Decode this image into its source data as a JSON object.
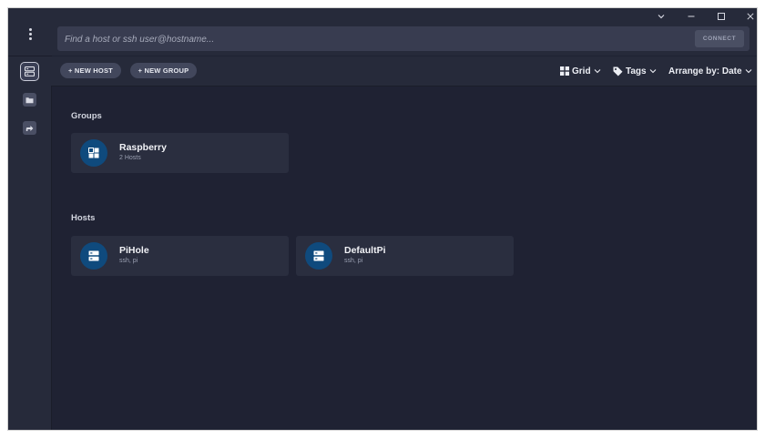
{
  "window_controls": {
    "dropdown": "⌄",
    "minimize": "–",
    "maximize": "☐",
    "close": "✕"
  },
  "search": {
    "placeholder": "Find a host or ssh user@hostname...",
    "value": "",
    "connect_label": "CONNECT"
  },
  "sidebar": {
    "items": [
      {
        "name": "hosts",
        "icon": "server-icon",
        "active": true
      },
      {
        "name": "snippets",
        "icon": "folder-icon",
        "active": false
      },
      {
        "name": "port-forwarding",
        "icon": "forward-arrow-icon",
        "active": false
      }
    ]
  },
  "toolbar": {
    "new_host_label": "+ NEW HOST",
    "new_group_label": "+ NEW GROUP",
    "view_label": "Grid",
    "tags_label": "Tags",
    "arrange_label": "Arrange by: Date"
  },
  "groups": {
    "title": "Groups",
    "items": [
      {
        "name": "Raspberry",
        "subtitle": "2 Hosts",
        "icon": "group-icon"
      }
    ]
  },
  "hosts": {
    "title": "Hosts",
    "items": [
      {
        "name": "PiHole",
        "subtitle": "ssh, pi",
        "icon": "server-icon"
      },
      {
        "name": "DefaultPi",
        "subtitle": "ssh, pi",
        "icon": "server-icon"
      }
    ]
  },
  "colors": {
    "accent": "#0f4a7d",
    "background": "#1f2233",
    "panel": "#262a3a",
    "card": "#2a2e3f"
  }
}
